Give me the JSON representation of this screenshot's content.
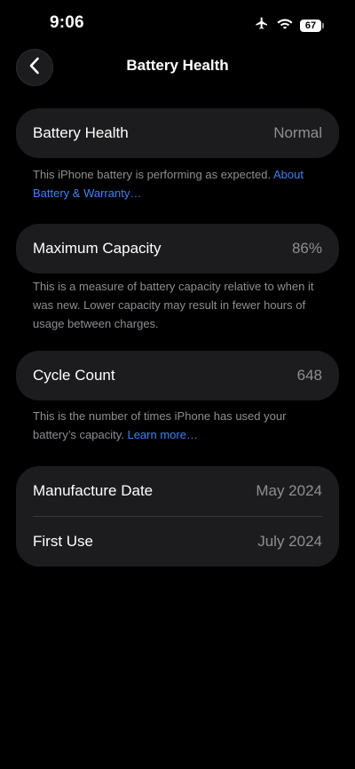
{
  "status_bar": {
    "time": "9:06",
    "battery_level": "67",
    "icons": [
      "airplane-icon",
      "wifi-icon",
      "battery-icon"
    ]
  },
  "nav": {
    "title": "Battery Health",
    "back_icon": "chevron-left-icon"
  },
  "battery_health": {
    "label": "Battery Health",
    "value": "Normal",
    "footer_text": "This iPhone battery is performing as expected. ",
    "footer_link": "About Battery & Warranty…"
  },
  "maximum_capacity": {
    "label": "Maximum Capacity",
    "value": "86%",
    "footer_text": "This is a measure of battery capacity relative to when it was new. Lower capacity may result in fewer hours of usage between charges."
  },
  "cycle_count": {
    "label": "Cycle Count",
    "value": "648",
    "footer_text": "This is the number of times iPhone has used your battery’s capacity. ",
    "footer_link": "Learn more…"
  },
  "dates": {
    "manufacture_label": "Manufacture Date",
    "manufacture_value": "May 2024",
    "first_use_label": "First Use",
    "first_use_value": "July 2024"
  },
  "colors": {
    "background": "#000000",
    "cell": "#1c1c1e",
    "secondary_text": "#8e8e93",
    "link": "#3b82f6"
  }
}
